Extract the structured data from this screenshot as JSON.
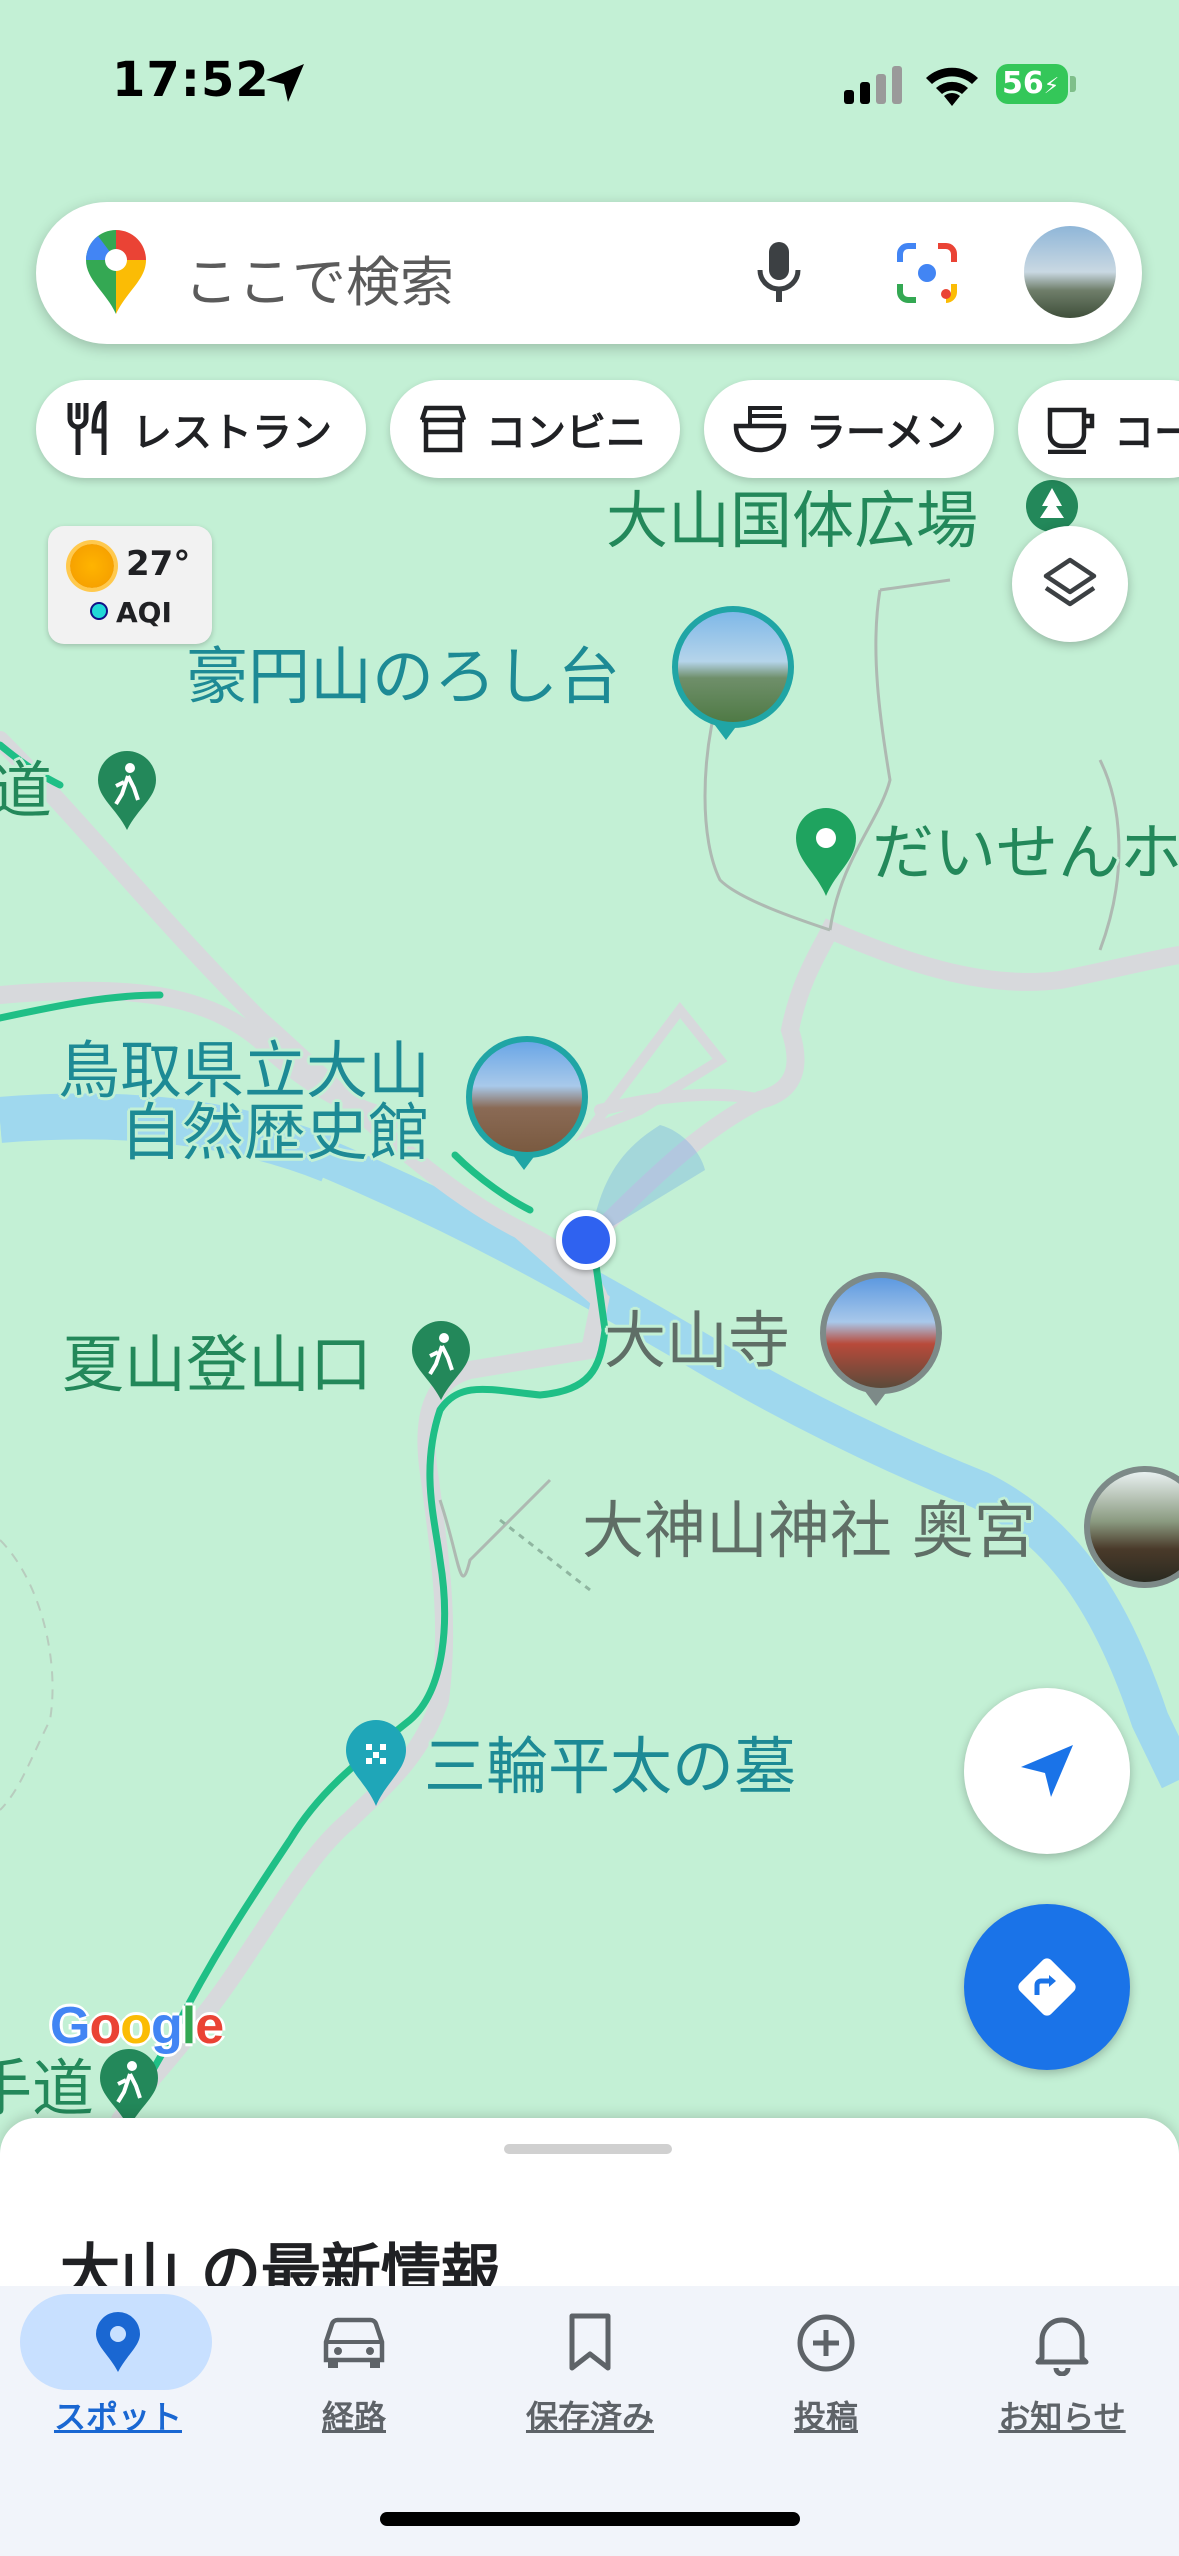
{
  "status_bar": {
    "time": "17:52",
    "battery": "56"
  },
  "search": {
    "placeholder": "ここで検索",
    "icons": [
      "maps-pin-icon",
      "microphone-icon",
      "lens-icon",
      "profile-avatar"
    ]
  },
  "chips": [
    {
      "label": "レストラン",
      "icon": "restaurant-icon"
    },
    {
      "label": "コンビニ",
      "icon": "store-icon"
    },
    {
      "label": "ラーメン",
      "icon": "ramen-icon"
    },
    {
      "label": "コー",
      "icon": "coffee-icon"
    }
  ],
  "weather": {
    "temp": "27°",
    "aqi": "AQI"
  },
  "map_labels": {
    "park": "大山国体広場",
    "lookout": "豪円山のろし台",
    "trail_left": "道",
    "daisen": "だいせんホ",
    "museum_line1": "鳥取県立大山",
    "museum_line2": "自然歴史館",
    "summer_trailhead": "夏山登山口",
    "temple": "大山寺",
    "shrine": "大神山神社 奥宮",
    "grave": "三輪平太の墓",
    "trail_bottom": "手道"
  },
  "google_logo": "Google",
  "sheet": {
    "title": "大山 の最新情報"
  },
  "tabs": [
    {
      "label": "スポット",
      "icon": "pin-icon",
      "active": true
    },
    {
      "label": "経路",
      "icon": "car-icon",
      "active": false
    },
    {
      "label": "保存済み",
      "icon": "bookmark-icon",
      "active": false
    },
    {
      "label": "投稿",
      "icon": "plus-circle-icon",
      "active": false
    },
    {
      "label": "お知らせ",
      "icon": "bell-icon",
      "active": false
    }
  ],
  "colors": {
    "map_bg": "#c3f0d5",
    "water": "#9fd8ee",
    "road": "#d7d9dc",
    "route": "#1fbf86",
    "accent_blue": "#1a73e8"
  }
}
